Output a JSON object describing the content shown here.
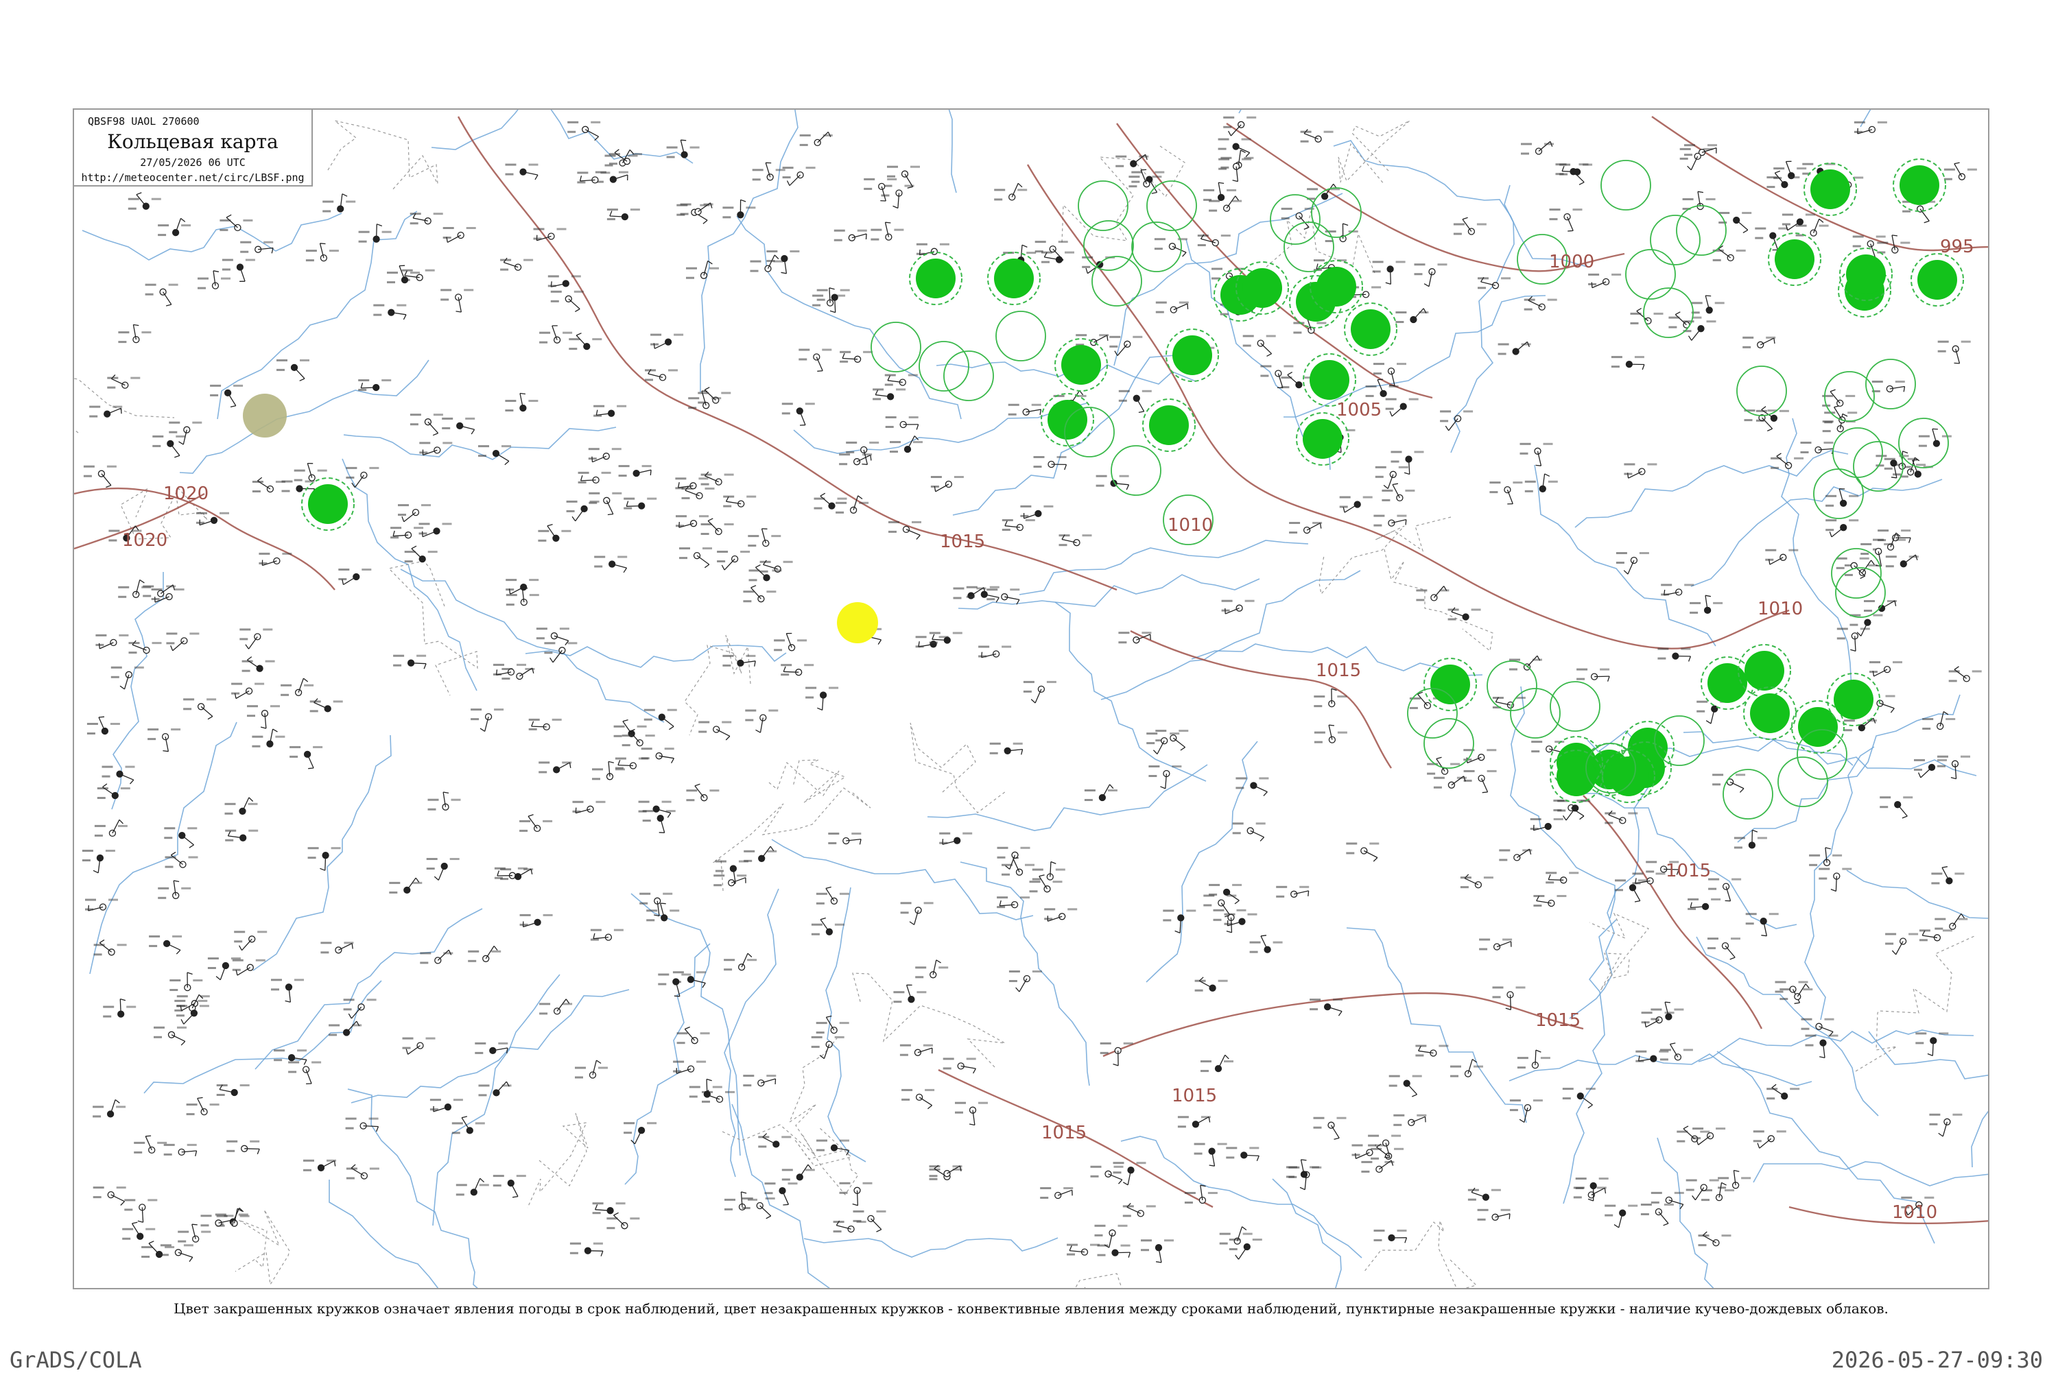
{
  "header": {
    "code": "QBSF98  UAOL  270600",
    "title": "Кольцевая карта",
    "date": "27/05/2026 06 UTC",
    "url": "http://meteocenter.net/circ/LBSF.png"
  },
  "legend_note": "Цвет закрашенных кружков означает явления погоды в срок наблюдений, цвет незакрашенных кружков - конвективные явления между сроками наблюдений, пунктирные незакрашенные кружки - наличие кучево-дождевых облаков.",
  "footer": {
    "left": "GrADS/COLA",
    "right": "2026-05-27-09:30"
  },
  "colors": {
    "river": "#6fa6d8",
    "border": "#a0524a",
    "isobar": "#a0524a",
    "shower_fill": "#13c21b",
    "cb_ring": "#39b84a",
    "thunder_fill": "#f7f71a",
    "haze_fill": "#b5b582"
  },
  "isobars": [
    {
      "label": "1020"
    },
    {
      "label": "1020"
    },
    {
      "label": "1015"
    },
    {
      "label": "1010"
    },
    {
      "label": "1005"
    },
    {
      "label": "1000"
    },
    {
      "label": "995"
    },
    {
      "label": "1010"
    },
    {
      "label": "1015"
    },
    {
      "label": "1015"
    },
    {
      "label": "1015"
    },
    {
      "label": "1010"
    },
    {
      "label": "1015"
    },
    {
      "label": "1015"
    }
  ]
}
